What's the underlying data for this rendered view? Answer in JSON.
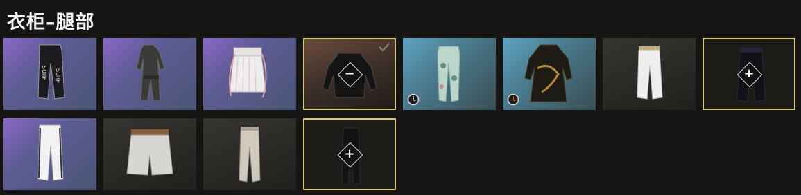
{
  "page": {
    "title": "衣柜–腿部"
  },
  "glyphs": {
    "remove": "−",
    "add": "+"
  },
  "colors": {
    "selected_border": "#d9c878",
    "background": "#161513"
  },
  "items": [
    {
      "id": "surf-pants",
      "bg": "purple",
      "icon": "surf-print-pants-icon"
    },
    {
      "id": "dark-jumpsuit",
      "bg": "purple",
      "icon": "dark-jumpsuit-icon"
    },
    {
      "id": "white-skirt",
      "bg": "purple",
      "icon": "pleated-skirt-icon"
    },
    {
      "id": "black-jacket-equipped",
      "bg": "brown",
      "icon": "leather-jacket-icon",
      "selected": true,
      "equipped": true
    },
    {
      "id": "floral-leggings",
      "bg": "blue",
      "icon": "floral-leggings-icon",
      "timed": true
    },
    {
      "id": "dragon-dress",
      "bg": "blue",
      "icon": "dragon-dress-icon",
      "timed": true
    },
    {
      "id": "white-pants",
      "bg": "gray",
      "icon": "white-pants-icon"
    },
    {
      "id": "black-pants-add",
      "bg": "dark",
      "icon": "black-pants-icon",
      "selected": true
    },
    {
      "id": "white-striped-pants",
      "bg": "purple",
      "icon": "striped-pants-icon"
    },
    {
      "id": "white-shorts",
      "bg": "gray",
      "icon": "shorts-icon"
    },
    {
      "id": "khaki-pants",
      "bg": "gray",
      "icon": "khaki-pants-icon"
    },
    {
      "id": "black-slim-pants-add",
      "bg": "dark",
      "icon": "slim-pants-icon",
      "selected": true
    }
  ]
}
